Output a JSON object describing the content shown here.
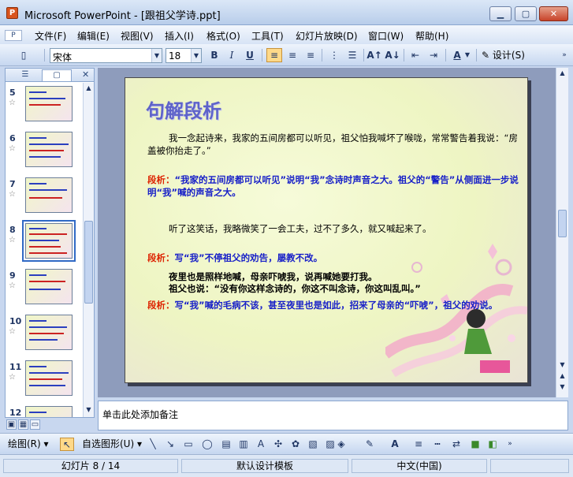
{
  "window": {
    "title": "Microsoft PowerPoint - [跟祖父学诗.ppt]",
    "app_icon_letter": "P",
    "controls": {
      "minimize": "▁",
      "maximize": "▢",
      "close": "✕"
    }
  },
  "menu": {
    "items": [
      "文件(F)",
      "编辑(E)",
      "视图(V)",
      "插入(I)",
      "格式(O)",
      "工具(T)",
      "幻灯片放映(D)",
      "窗口(W)",
      "帮助(H)"
    ]
  },
  "toolbar": {
    "font_name": "宋体",
    "font_size": "18",
    "bold": "B",
    "italic": "I",
    "underline": "U",
    "design_label": "设计(S)"
  },
  "slides_pane": {
    "tabs": [
      "☰",
      "▢"
    ],
    "close": "✕",
    "visible_numbers": [
      "5",
      "6",
      "7",
      "8",
      "9",
      "10",
      "11",
      "12"
    ],
    "selected": "8"
  },
  "slide": {
    "title": "句解段析",
    "para1": "我一念起诗来，我家的五间房都可以听见，祖父怕我喊坏了喉咙，常常警告着我说：“房盖被你抬走了。”",
    "analysis1_label": "段析：",
    "analysis1_text": "“我家的五间房都可以听见”说明“我”念诗时声音之大。祖父的“警告”从侧面进一步说明“我”喊的声音之大。",
    "para2": "听了这笑话，我略微笑了一会工夫，过不了多久，就又喊起来了。",
    "analysis2_label": "段析：",
    "analysis2_text": "写“我”不停祖父的劝告，屡教不改。",
    "para3_line1": "夜里也是照样地喊，母亲吓唬我，说再喊她要打我。",
    "para3_line2": "祖父也说：“没有你这样念诗的，你这不叫念诗，你这叫乱叫。”",
    "analysis3_label": "段析：",
    "analysis3_text": "写“我”喊的毛病不该，甚至夜里也是如此，招来了母亲的“吓唬”，祖父的劝说。"
  },
  "notes": {
    "placeholder": "单击此处添加备注"
  },
  "drawing_toolbar": {
    "draw_label": "绘图(R)",
    "autoshape_label": "自选图形(U)"
  },
  "status": {
    "slide_info": "幻灯片 8 / 14",
    "template": "默认设计模板",
    "language": "中文(中国)"
  },
  "colors": {
    "title_blue": "#5e63c9",
    "analysis_label_red": "#dd2200",
    "analysis_text_blue": "#1820c8"
  }
}
